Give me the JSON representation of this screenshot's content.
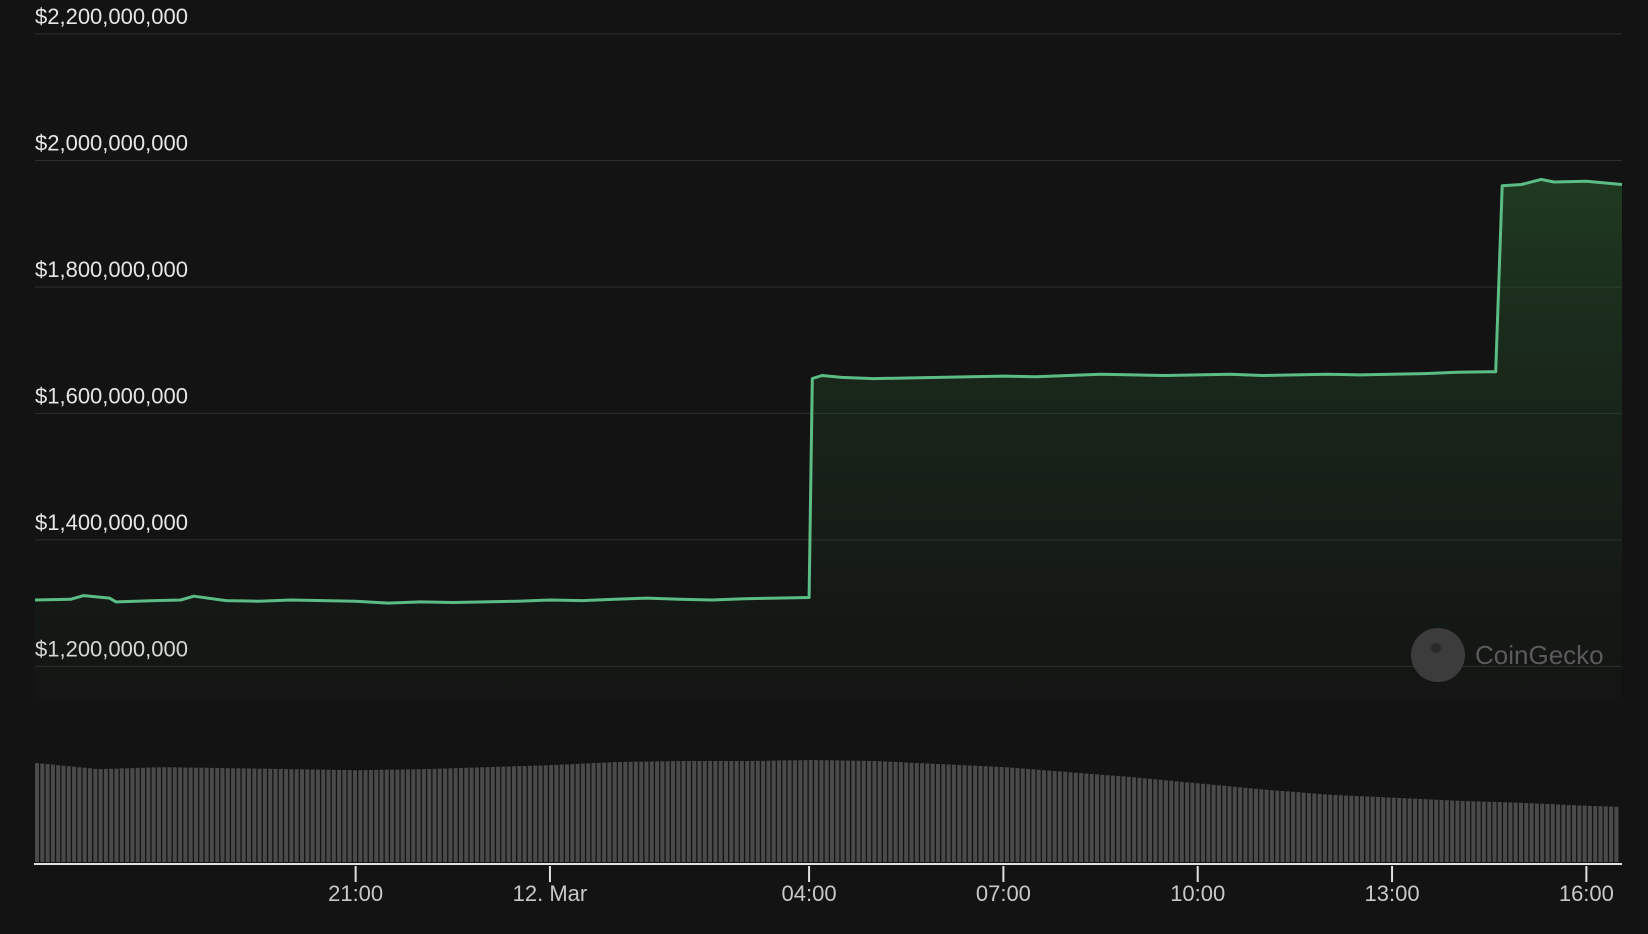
{
  "chart_data": {
    "type": "area",
    "title": "",
    "xlabel": "",
    "ylabel": "",
    "ylim": [
      1150000000,
      2200000000
    ],
    "y_ticks": [
      {
        "value": 1200000000,
        "label": "$1,200,000,000"
      },
      {
        "value": 1400000000,
        "label": "$1,400,000,000"
      },
      {
        "value": 1600000000,
        "label": "$1,600,000,000"
      },
      {
        "value": 1800000000,
        "label": "$1,800,000,000"
      },
      {
        "value": 2000000000,
        "label": "$2,000,000,000"
      },
      {
        "value": 2200000000,
        "label": "$2,200,000,000"
      }
    ],
    "x_range_hours": [
      16.05,
      40.55
    ],
    "x_ticks": [
      {
        "hour": 21,
        "label": "21:00"
      },
      {
        "hour": 24,
        "label": "12. Mar"
      },
      {
        "hour": 28,
        "label": "04:00"
      },
      {
        "hour": 31,
        "label": "07:00"
      },
      {
        "hour": 34,
        "label": "10:00"
      },
      {
        "hour": 37,
        "label": "13:00"
      },
      {
        "hour": 40,
        "label": "16:00"
      }
    ],
    "grid": true,
    "legend": "none",
    "series": [
      {
        "name": "",
        "color": "#5bbd85",
        "x_hours": [
          16.05,
          16.6,
          16.8,
          17.2,
          17.3,
          17.6,
          17.9,
          18.3,
          18.5,
          19.0,
          19.5,
          20.0,
          20.5,
          21.0,
          21.5,
          22.0,
          22.5,
          23.0,
          23.5,
          24.0,
          24.5,
          25.0,
          25.5,
          26.0,
          26.5,
          27.0,
          27.5,
          28.0,
          28.05,
          28.2,
          28.5,
          29.0,
          29.5,
          30.0,
          30.5,
          31.0,
          31.5,
          32.0,
          32.5,
          33.0,
          33.5,
          34.0,
          34.5,
          35.0,
          35.5,
          36.0,
          36.5,
          37.0,
          37.5,
          38.0,
          38.5,
          38.6,
          38.7,
          39.0,
          39.3,
          39.5,
          40.0,
          40.55
        ],
        "values": [
          1305000000,
          1306000000,
          1312000000,
          1308000000,
          1302000000,
          1303000000,
          1304000000,
          1305000000,
          1311000000,
          1304000000,
          1303000000,
          1305000000,
          1304000000,
          1303000000,
          1300000000,
          1302000000,
          1301000000,
          1302000000,
          1303000000,
          1305000000,
          1304000000,
          1306000000,
          1308000000,
          1306000000,
          1305000000,
          1307000000,
          1308000000,
          1309000000,
          1655000000,
          1660000000,
          1657000000,
          1655000000,
          1656000000,
          1657000000,
          1658000000,
          1659000000,
          1658000000,
          1660000000,
          1662000000,
          1661000000,
          1660000000,
          1661000000,
          1662000000,
          1660000000,
          1661000000,
          1662000000,
          1661000000,
          1662000000,
          1663000000,
          1665000000,
          1666000000,
          1666000000,
          1960000000,
          1962000000,
          1970000000,
          1966000000,
          1967000000,
          1962000000
        ]
      }
    ],
    "volume": {
      "color": "#4a4a4a",
      "unit": "relative",
      "x_hours": [
        16.05,
        17,
        18,
        19,
        20,
        21,
        22,
        23,
        24,
        25,
        26,
        27,
        28,
        29,
        30,
        31,
        32,
        33,
        34,
        35,
        36,
        37,
        38,
        39,
        40,
        40.55
      ],
      "values": [
        0.97,
        0.91,
        0.93,
        0.92,
        0.91,
        0.9,
        0.91,
        0.93,
        0.95,
        0.98,
        0.99,
        0.99,
        1.0,
        0.99,
        0.96,
        0.93,
        0.88,
        0.83,
        0.77,
        0.71,
        0.66,
        0.63,
        0.6,
        0.58,
        0.55,
        0.54
      ]
    }
  },
  "watermark": {
    "text": "CoinGecko"
  }
}
